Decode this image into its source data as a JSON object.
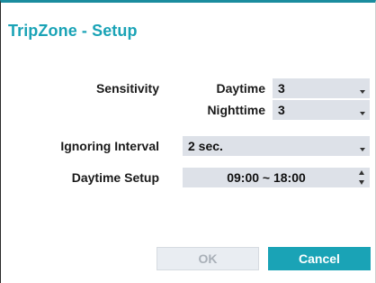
{
  "dialog": {
    "title": "TripZone - Setup"
  },
  "sensitivity": {
    "label": "Sensitivity",
    "daytime_label": "Daytime",
    "daytime_value": "3",
    "nighttime_label": "Nighttime",
    "nighttime_value": "3"
  },
  "ignoring_interval": {
    "label": "Ignoring Interval",
    "value": "2 sec."
  },
  "daytime_setup": {
    "label": "Daytime Setup",
    "value": "09:00 ~ 18:00"
  },
  "buttons": {
    "ok_label": "OK",
    "cancel_label": "Cancel"
  },
  "colors": {
    "accent": "#1aa3b6",
    "field_bg": "#dde1e8",
    "disabled_text": "#a9b0b8"
  },
  "icons": {
    "dropdown": "chevron-down-icon",
    "spinner": "spinner-arrows-icon"
  }
}
